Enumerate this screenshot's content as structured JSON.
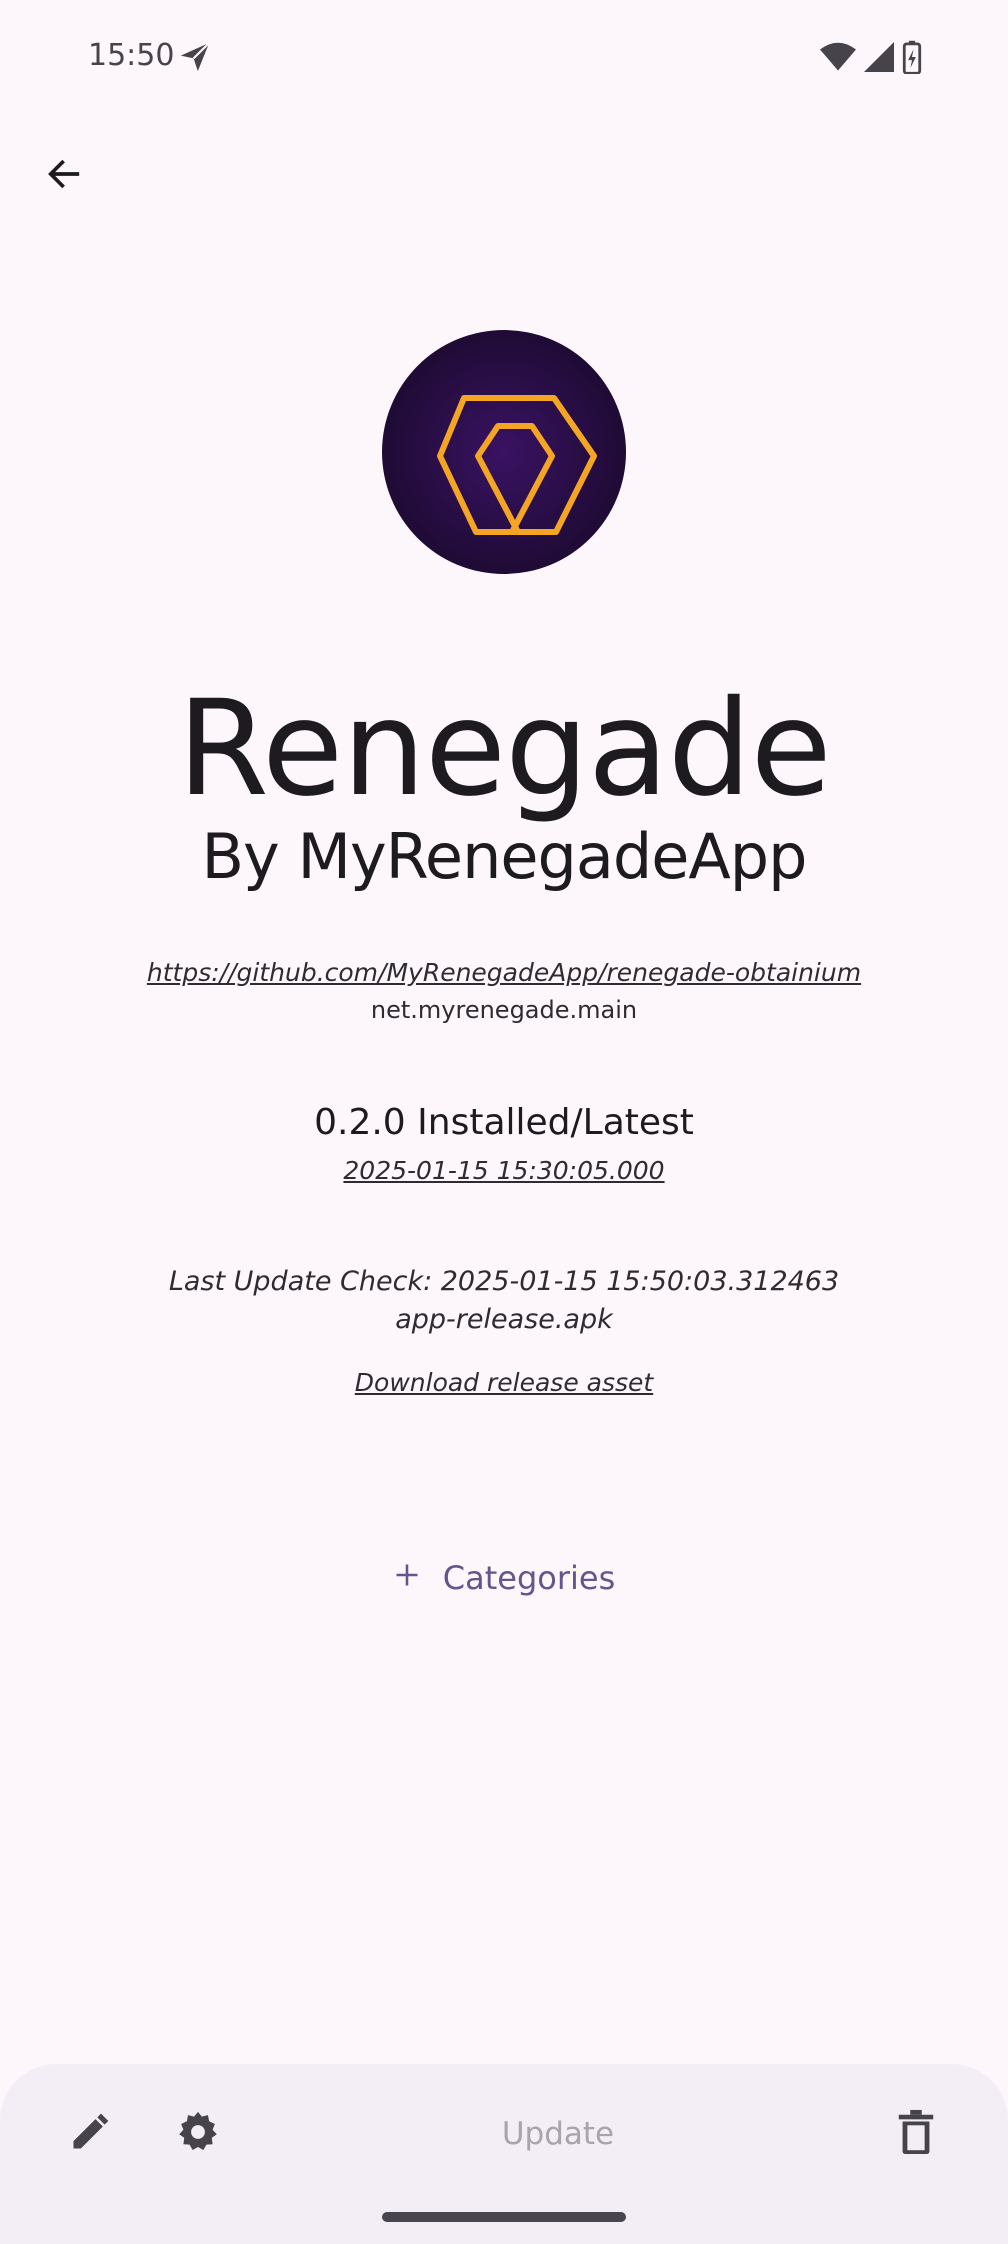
{
  "status_bar": {
    "time": "15:50",
    "icons": [
      "telegram-send-icon",
      "wifi-icon",
      "signal-icon",
      "battery-charging-icon"
    ]
  },
  "toolbar": {
    "back_icon": "arrow-left-icon"
  },
  "app": {
    "name": "Renegade",
    "author": "By MyRenegadeApp",
    "url": "https://github.com/MyRenegadeApp/renegade-obtainium",
    "package": "net.myrenegade.main",
    "version": "0.2.0 Installed/Latest",
    "release_date": "2025-01-15 15:30:05.000",
    "last_update_check": "Last Update Check: 2025-01-15 15:50:03.312463",
    "apk": "app-release.apk",
    "download_link": "Download release asset",
    "categories_label": "Categories"
  },
  "bottom_bar": {
    "edit_icon": "pencil-icon",
    "settings_icon": "gear-icon",
    "update_label": "Update",
    "delete_icon": "trash-icon"
  },
  "colors": {
    "background": "#fdf7fb",
    "bottom_bar": "#f3edf5",
    "accent": "#65558f",
    "logo_bg": "#2a0d45",
    "logo_stroke": "#f5a524",
    "disabled_text": "#a8a4ab"
  }
}
